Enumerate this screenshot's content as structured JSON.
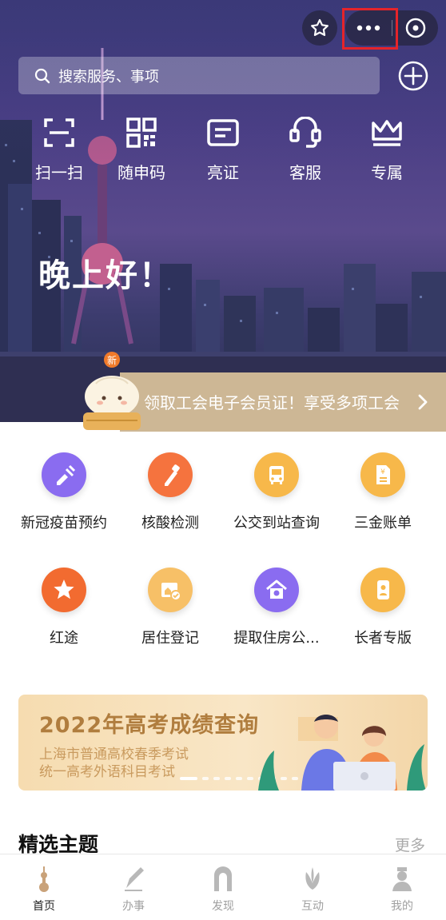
{
  "top_actions": {
    "star_icon": "star-icon",
    "more_icon": "more-dots-icon",
    "close_icon": "close-circle-icon"
  },
  "search": {
    "placeholder": "搜索服务、事项"
  },
  "quick_actions": [
    {
      "label": "扫一扫",
      "icon": "scan-icon"
    },
    {
      "label": "随申码",
      "icon": "qr-code-icon"
    },
    {
      "label": "亮证",
      "icon": "card-icon"
    },
    {
      "label": "客服",
      "icon": "headset-icon"
    },
    {
      "label": "专属",
      "icon": "crown-icon"
    }
  ],
  "greeting": "晚上好！",
  "banner": {
    "badge": "新",
    "text": "领取工会电子会员证！享受多项工会"
  },
  "services": [
    {
      "label": "新冠疫苗预约",
      "icon": "syringe-icon",
      "color": "#8a6cf0"
    },
    {
      "label": "核酸检测",
      "icon": "test-tube-icon",
      "color": "#f5733e"
    },
    {
      "label": "公交到站查询",
      "icon": "bus-icon",
      "color": "#f7b84a"
    },
    {
      "label": "三金账单",
      "icon": "bill-icon",
      "color": "#f7b84a"
    },
    {
      "label": "红途",
      "icon": "red-star-icon",
      "color": "#f26b30"
    },
    {
      "label": "居住登记",
      "icon": "residence-icon",
      "color": "#f7c067"
    },
    {
      "label": "提取住房公...",
      "icon": "house-fund-icon",
      "color": "#8a6cf0"
    },
    {
      "label": "长者专版",
      "icon": "elder-phone-icon",
      "color": "#f7b84a"
    }
  ],
  "promo": {
    "title": "2022年高考成绩查询",
    "line1": "上海市普通高校春季考试",
    "line2": "统一高考外语科目考试"
  },
  "section": {
    "title": "精选主题",
    "more": "更多"
  },
  "tabs": [
    {
      "label": "首页",
      "icon": "home-tower-icon",
      "active": true
    },
    {
      "label": "办事",
      "icon": "pen-icon",
      "active": false
    },
    {
      "label": "发现",
      "icon": "discover-arch-icon",
      "active": false
    },
    {
      "label": "互动",
      "icon": "magnolia-icon",
      "active": false
    },
    {
      "label": "我的",
      "icon": "profile-icon",
      "active": false
    }
  ],
  "colors": {
    "highlight": "#e5242a",
    "banner": "#cdb795",
    "promo_title": "#b07d3e"
  }
}
